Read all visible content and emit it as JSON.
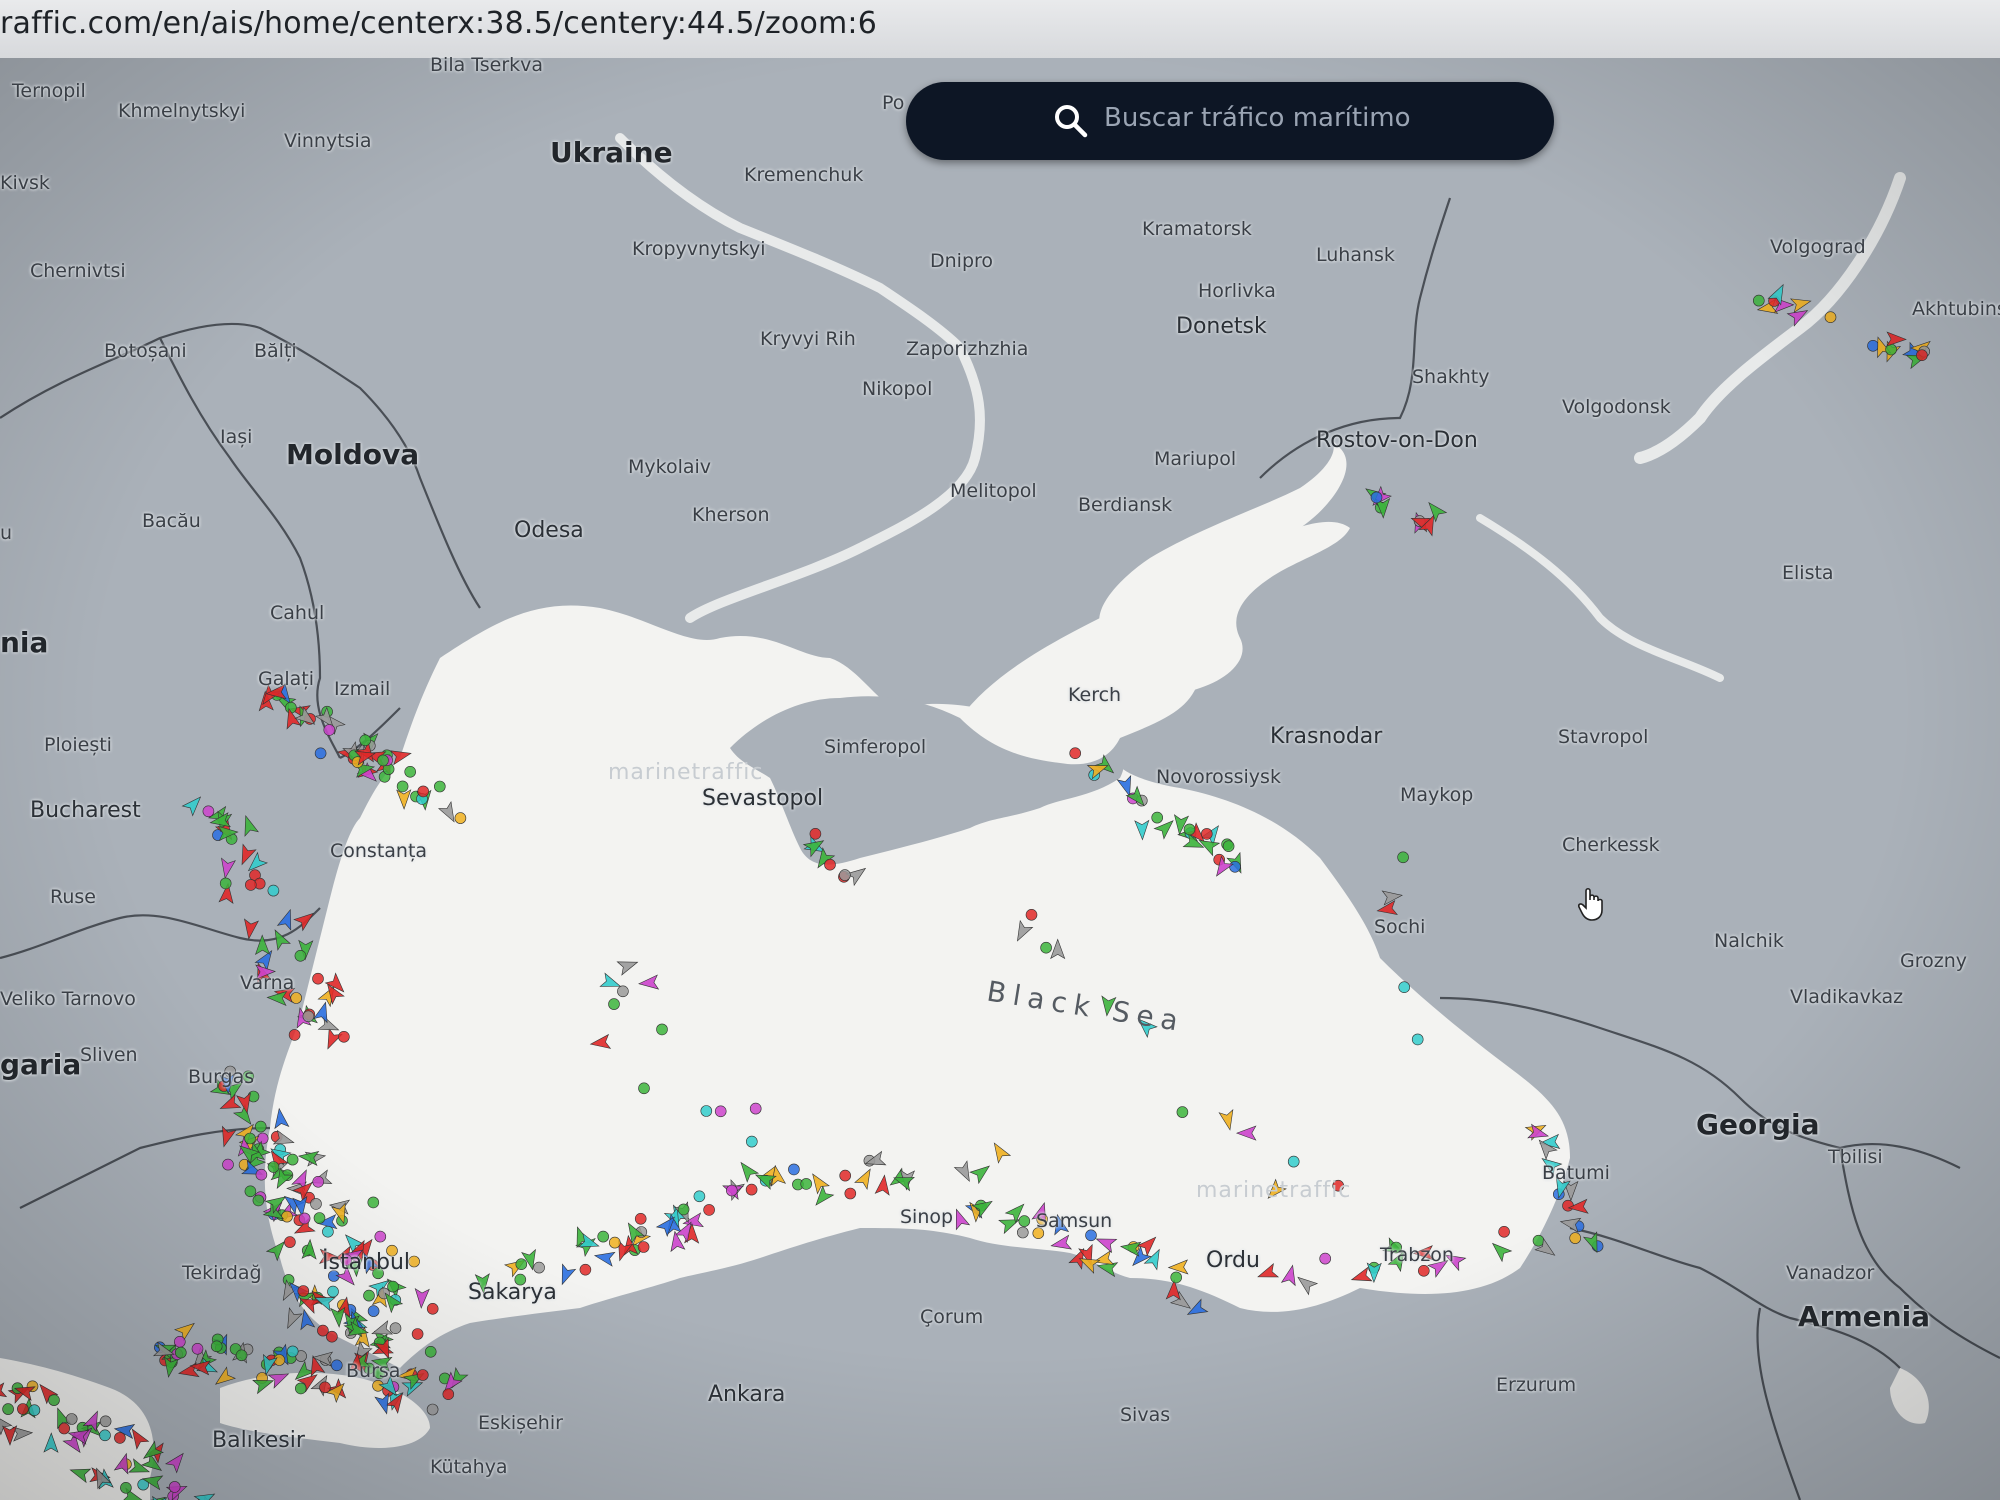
{
  "browser": {
    "url": "raffic.com/en/ais/home/centerx:38.5/centery:44.5/zoom:6"
  },
  "search": {
    "placeholder": "Buscar tráfico marítimo",
    "icon": "search-icon"
  },
  "map": {
    "sea_label": "Black Sea",
    "watermarks": [
      "marinetraffic",
      "marinetraffic"
    ],
    "countries": [
      "Ukraine",
      "Moldova",
      "nia",
      "garia",
      "Georgia",
      "Armenia"
    ],
    "places": [
      "Ternopil",
      "Khmelnytskyi",
      "Vinnytsia",
      "Bila Tserkva",
      "Kremenchuk",
      "Kropyvnytskyi",
      "Dnipro",
      "Kramatorsk",
      "Luhansk",
      "Horlivka",
      "Donetsk",
      "Kryvyi Rih",
      "Zaporizhzhia",
      "Nikopol",
      "Mykolaiv",
      "Kherson",
      "Odesa",
      "Melitopol",
      "Berdiansk",
      "Mariupol",
      "Rostov-on-Don",
      "Shakhty",
      "Volgodonsk",
      "Volgograd",
      "Akhtubinsk",
      "Elista",
      "Chernivtsi",
      "Botoșani",
      "Bălți",
      "Iași",
      "Bacău",
      "Cahul",
      "Galați",
      "Izmail",
      "Ploiești",
      "Bucharest",
      "Constanța",
      "Ruse",
      "Varna",
      "Veliko Tarnovo",
      "Sliven",
      "Burgas",
      "Simferopol",
      "Sevastopol",
      "Kerch",
      "Krasnodar",
      "Novorossiysk",
      "Stavropol",
      "Maykop",
      "Cherkessk",
      "Sochi",
      "Nalchik",
      "Grozny",
      "Vladikavkaz",
      "Tbilisi",
      "Batumi",
      "Trabzon",
      "Ordu",
      "Samsun",
      "Sinop",
      "Çorum",
      "Sivas",
      "Erzurum",
      "Vanadzor",
      "Ankara",
      "Eskișehir",
      "Kütahya",
      "Balıkesir",
      "Bursa",
      "Sakarya",
      "İstanbul",
      "Tekirdağ",
      "Po",
      "Kivsk",
      "u"
    ]
  },
  "vessel_colors": {
    "cargo": "#3cb43c",
    "tanker": "#e02828",
    "passenger": "#2a6fe0",
    "tug_special": "#33cccc",
    "pleasure": "#cc44cc",
    "highspeed": "#f0b020",
    "other": "#9a9a9a"
  }
}
